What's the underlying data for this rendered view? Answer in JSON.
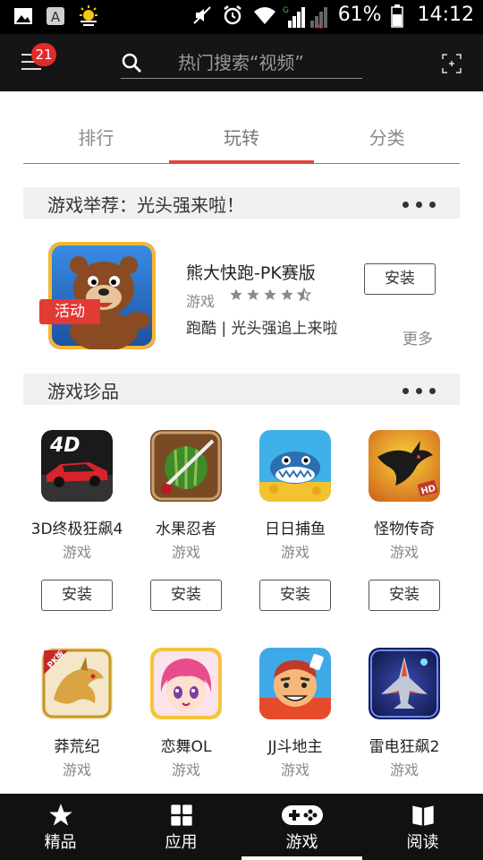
{
  "status_bar": {
    "battery_percent": "61%",
    "time": "14:12"
  },
  "top_bar": {
    "notification_count": "21",
    "search_placeholder": "热门搜索“视频”"
  },
  "tabs": [
    {
      "label": "排行",
      "active": false
    },
    {
      "label": "玩转",
      "active": true
    },
    {
      "label": "分类",
      "active": false
    }
  ],
  "featured_section": {
    "title": "游戏举荐：光头强来啦！",
    "game": {
      "name": "熊大快跑-PK赛版",
      "category": "游戏",
      "rating": 4.5,
      "description": "跑酷 | 光头强追上来啦",
      "tag": "活动",
      "install_label": "安装",
      "more_label": "更多"
    }
  },
  "gems_section": {
    "title": "游戏珍品",
    "apps": [
      {
        "name": "3D终极狂飙4",
        "category": "游戏",
        "install_label": "安装",
        "icon": "racing-car-icon",
        "icon_text": "4D"
      },
      {
        "name": "水果忍者",
        "category": "游戏",
        "install_label": "安装",
        "icon": "sliced-watermelon-icon"
      },
      {
        "name": "日日捕鱼",
        "category": "游戏",
        "install_label": "安装",
        "icon": "shark-icon"
      },
      {
        "name": "怪物传奇",
        "category": "游戏",
        "install_label": "安装",
        "icon": "dragon-icon",
        "icon_text": "HD"
      },
      {
        "name": "莽荒纪",
        "category": "游戏",
        "icon": "golden-dragon-icon",
        "icon_text": "PK版"
      },
      {
        "name": "恋舞OL",
        "category": "游戏",
        "icon": "anime-girl-icon"
      },
      {
        "name": "JJ斗地主",
        "category": "游戏",
        "icon": "cartoon-man-icon"
      },
      {
        "name": "雷电狂飙2",
        "category": "游戏",
        "icon": "fighter-jet-icon"
      }
    ]
  },
  "bottom_nav": [
    {
      "label": "精品",
      "icon": "star-icon",
      "active": false
    },
    {
      "label": "应用",
      "icon": "grid-icon",
      "active": false
    },
    {
      "label": "游戏",
      "icon": "gamepad-icon",
      "active": true
    },
    {
      "label": "阅读",
      "icon": "book-icon",
      "active": false
    }
  ],
  "colors": {
    "accent": "#e2443a",
    "top_bar_bg": "#151515",
    "section_bg": "#f0f0f0"
  }
}
